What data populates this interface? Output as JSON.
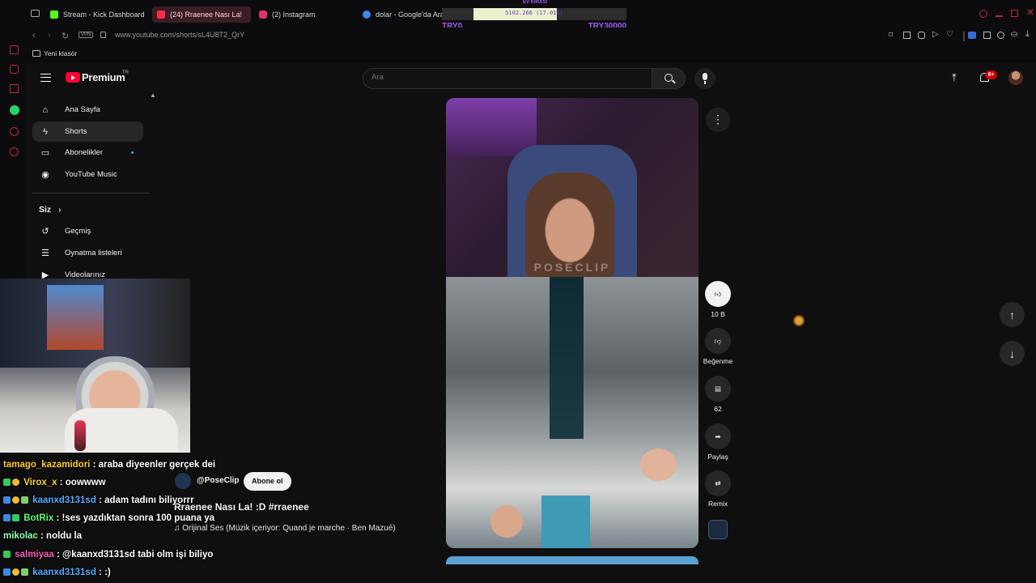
{
  "browser": {
    "tabs": [
      {
        "label": "Stream - Kick Dashboard",
        "color": "#53fc18"
      },
      {
        "label": "(24) Rraenee Nası La!",
        "color": "#ff2a4a",
        "active": true
      },
      {
        "label": "(2) Instagram",
        "color": "#e1306c"
      },
      {
        "label": "dolar - Google'da Ara",
        "color": "#4285f4"
      }
    ],
    "url": "www.youtube.com/shorts/sL4U8T2_QrY",
    "vpn": "VPN",
    "bookmark_folder": "Yeni klasör"
  },
  "goal_overlay": {
    "title": "EV KİRASI",
    "progress_text": "5102.266 (17.01%)",
    "progress_fraction": 0.1701,
    "min_label": "TRY0",
    "max_label": "TRY30000"
  },
  "youtube": {
    "logo_text": "Premium",
    "logo_region": "TR",
    "search_placeholder": "Ara",
    "notification_count": "9+",
    "sidebar": {
      "items": [
        {
          "label": "Ana Sayfa",
          "icon": "home-icon"
        },
        {
          "label": "Shorts",
          "icon": "shorts-icon",
          "selected": true
        },
        {
          "label": "Abonelikler",
          "icon": "subscriptions-icon"
        },
        {
          "label": "YouTube Music",
          "icon": "music-icon"
        }
      ],
      "you_label": "Siz",
      "you_items": [
        {
          "label": "Geçmiş",
          "icon": "history-icon"
        },
        {
          "label": "Oynatma listeleri",
          "icon": "playlists-icon"
        },
        {
          "label": "Videolarınız",
          "icon": "your-videos-icon"
        }
      ]
    },
    "short": {
      "watermark": "POSECLIP",
      "channel": "@PoseClip",
      "subscribe_label": "Abone ol",
      "title": "Rraenee Nası La! :D  #rraenee",
      "audio": "Orijinal Ses (Müzik içeriyor: Quand je marche · Ben Mazué)"
    },
    "actions": {
      "like_count": "10 B",
      "dislike_label": "Beğenme",
      "comment_count": "62",
      "share_label": "Paylaş",
      "remix_label": "Remix"
    }
  },
  "stream_chat": [
    {
      "user": "tamago_kazamidori",
      "message": " : araba diyeenler gerçek dei",
      "color": "#ffc933",
      "badges": []
    },
    {
      "user": "Virox_x",
      "message": " : oowwww",
      "color": "#ffd83b",
      "badges": [
        "#35c95a",
        "#f2b82b"
      ]
    },
    {
      "user": "kaanxd3131sd",
      "message": " : adam tadını biliyorrr",
      "color": "#5aa9ff",
      "badges": [
        "#3a8be0",
        "#f2b82b",
        "#7fd06a"
      ]
    },
    {
      "user": "BotRix",
      "message": " : !ses yazdıktan sonra 100 puana ya",
      "color": "#59ff7a",
      "badges": [
        "#3a8be0",
        "#35c95a"
      ]
    },
    {
      "user": "mikolac",
      "message": " : noldu la",
      "color": "#8fffb0",
      "badges": []
    },
    {
      "user": "salmiyaa",
      "message": " : @kaanxd3131sd tabi olm işi biliyo",
      "color": "#ff5cb8",
      "badges": [
        "#35c95a"
      ]
    },
    {
      "user": "kaanxd3131sd",
      "message": " : :)",
      "color": "#5aa9ff",
      "badges": [
        "#3a8be0",
        "#f2b82b",
        "#7fd06a"
      ]
    }
  ]
}
